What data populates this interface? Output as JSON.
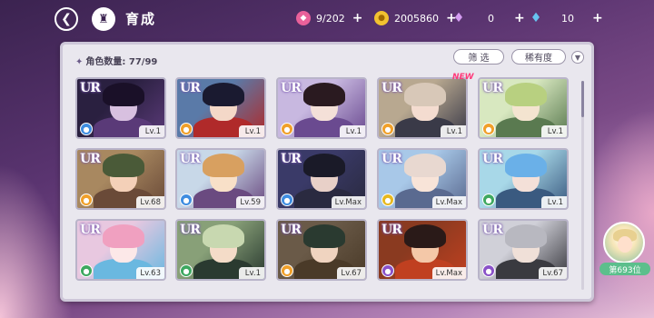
{
  "header": {
    "title": "育成",
    "resources": [
      {
        "name": "candy",
        "icon": "candy-icon",
        "value": "9/202"
      },
      {
        "name": "coin",
        "icon": "coin-icon",
        "value": "2005860"
      },
      {
        "name": "gem-purple",
        "icon": "purple-gem-icon",
        "value": "0"
      },
      {
        "name": "gem-blue",
        "icon": "blue-gem-icon",
        "value": "10"
      }
    ]
  },
  "panel": {
    "count_label": "角色数量: 77/99",
    "filter_label": "筛 选",
    "sort_label": "稀有度",
    "new_badge": "NEW"
  },
  "cards": [
    {
      "rarity": "UR",
      "level": "Lv.1",
      "element": "blue"
    },
    {
      "rarity": "UR",
      "level": "Lv.1",
      "element": "orange"
    },
    {
      "rarity": "UR",
      "level": "Lv.1",
      "element": "orange"
    },
    {
      "rarity": "UR",
      "level": "Lv.1",
      "element": "orange"
    },
    {
      "rarity": "UR",
      "level": "Lv.1",
      "element": "orange"
    },
    {
      "rarity": "UR",
      "level": "Lv.68",
      "element": "orange"
    },
    {
      "rarity": "UR",
      "level": "Lv.59",
      "element": "blue"
    },
    {
      "rarity": "UR",
      "level": "Lv.Max",
      "element": "blue"
    },
    {
      "rarity": "UR",
      "level": "Lv.Max",
      "element": "yellow"
    },
    {
      "rarity": "UR",
      "level": "Lv.1",
      "element": "green"
    },
    {
      "rarity": "UR",
      "level": "Lv.63",
      "element": "green"
    },
    {
      "rarity": "UR",
      "level": "Lv.1",
      "element": "green"
    },
    {
      "rarity": "UR",
      "level": "Lv.67",
      "element": "orange"
    },
    {
      "rarity": "UR",
      "level": "Lv.Max",
      "element": "purple"
    },
    {
      "rarity": "UR",
      "level": "Lv.67",
      "element": "purple"
    }
  ],
  "rank": {
    "label": "第693位"
  },
  "colors": {
    "element_blue": "#3f8de0",
    "element_orange": "#f0a02a",
    "element_yellow": "#e6b820",
    "element_green": "#3ea860",
    "element_purple": "#8a52c8",
    "accent_new": "#ff3a7a"
  }
}
